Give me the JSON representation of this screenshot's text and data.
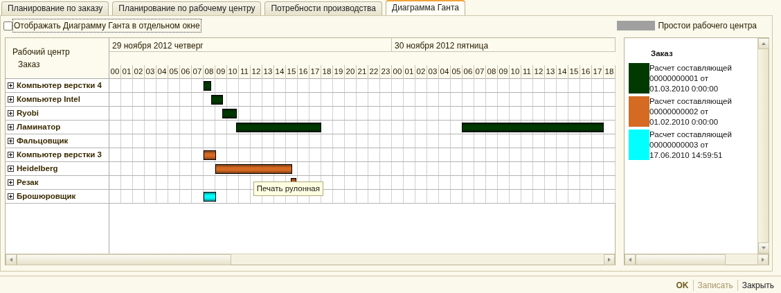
{
  "tabs": [
    {
      "label": "Планирование по заказу",
      "selected": false
    },
    {
      "label": "Планирование по рабочему центру",
      "selected": false
    },
    {
      "label": "Потребности производства",
      "selected": false
    },
    {
      "label": "Диаграмма Ганта",
      "selected": true
    }
  ],
  "separate_window": {
    "label": "Отображать Диаграмму Ганта в отдельном окне",
    "checked": false
  },
  "idle_legend": {
    "label": "Простои рабочего центра",
    "color": "#a0a0a0"
  },
  "gantt": {
    "header": {
      "work_center": "Рабочий центр",
      "order": "Заказ"
    },
    "days": [
      {
        "label": "29 ноября 2012 четверг"
      },
      {
        "label": "30 ноября 2012 пятница"
      }
    ],
    "hours": [
      "00",
      "01",
      "02",
      "03",
      "04",
      "05",
      "06",
      "07",
      "08",
      "09",
      "10",
      "11",
      "12",
      "13",
      "14",
      "15",
      "16",
      "17",
      "18",
      "19",
      "20",
      "21",
      "22",
      "23",
      "00",
      "01",
      "02",
      "03",
      "04",
      "05",
      "06",
      "07",
      "08",
      "09",
      "10",
      "11",
      "12",
      "13",
      "14",
      "15",
      "16",
      "17",
      "18"
    ],
    "rows": [
      {
        "name": "Компьютер верстки 4",
        "expanded": false,
        "bars": [
          {
            "color": "#003a00"
          }
        ]
      },
      {
        "name": "Компьютер Intel",
        "expanded": false,
        "bars": [
          {
            "color": "#003a00"
          }
        ]
      },
      {
        "name": "Ryobi",
        "expanded": false,
        "bars": [
          {
            "color": "#003a00"
          }
        ]
      },
      {
        "name": "Ламинатор",
        "expanded": false,
        "bars": [
          {
            "color": "#003a00"
          },
          {
            "color": "#003a00"
          }
        ]
      },
      {
        "name": "Фальцовщик",
        "expanded": false,
        "bars": []
      },
      {
        "name": "Компьютер верстки 3",
        "expanded": false,
        "bars": [
          {
            "color": "#d56a22"
          }
        ]
      },
      {
        "name": "Heidelberg",
        "expanded": false,
        "bars": [
          {
            "color": "#d56a22"
          }
        ]
      },
      {
        "name": "Резак",
        "expanded": false,
        "bars": [
          {
            "color": "#d56a22",
            "tooltip": "Печать рулонная"
          }
        ]
      },
      {
        "name": "Брошюровщик",
        "expanded": false,
        "bars": [
          {
            "color": "#00ffff"
          }
        ]
      }
    ]
  },
  "legend": {
    "title": "Заказ",
    "items": [
      {
        "label": "Расчет составляющей 00000000001 от 01.03.2010 0:00:00",
        "color": "#003a00"
      },
      {
        "label": "Расчет составляющей 00000000002 от 01.02.2010 0:00:00",
        "color": "#d56a22"
      },
      {
        "label": "Расчет составляющей 00000000003 от 17.06.2010 14:59:51",
        "color": "#00ffff"
      }
    ]
  },
  "footer": [
    {
      "label": "OK",
      "kind": "default",
      "disabled": false
    },
    {
      "label": "Записать",
      "kind": "normal",
      "disabled": true
    },
    {
      "label": "Закрыть",
      "kind": "normal",
      "disabled": false
    }
  ]
}
